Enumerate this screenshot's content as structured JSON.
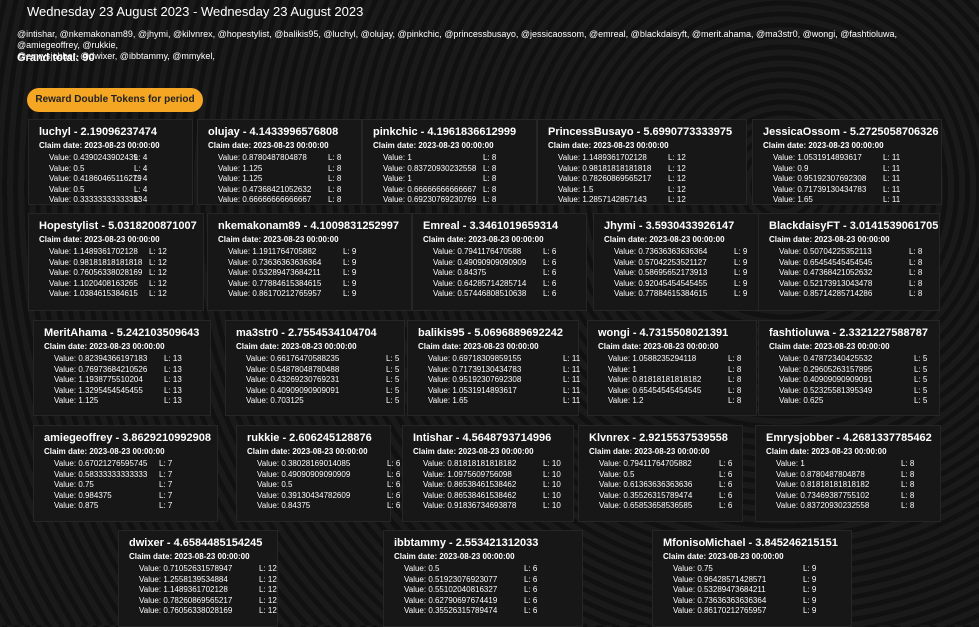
{
  "header": {
    "date_range": "Wednesday 23 August 2023 - Wednesday 23 August 2023",
    "users_line1": "@intishar, @nkemakonam89, @jhymi, @kilvnrex, @hopestylist, @balikis95, @luchyl, @olujay, @pinkchic, @princessbusayo, @jessicaossom, @emreal, @blackdaisyft, @merit.ahama, @ma3str0, @wongi, @fashtioluwa, @amiegeoffrey, @rukkie,",
    "users_line2": "@emrysjobber, @dwixer, @ibbtammy, @mmykel,",
    "grand_total": "Grand total: 90"
  },
  "reward_button": "Reward Double Tokens for period",
  "cards": [
    {
      "title": "luchyl - 2.19096237474",
      "claim": "Claim date: 2023-08-23 00:00:00",
      "rows": [
        [
          "Value: 0.4390243902439",
          "L: 4"
        ],
        [
          "Value: 0.5",
          "L: 4"
        ],
        [
          "Value: 0.41860465116279",
          "L: 4"
        ],
        [
          "Value: 0.5",
          "L: 4"
        ],
        [
          "Value: 0.33333333333333",
          "L: 4"
        ]
      ]
    },
    {
      "title": "olujay - 4.1433996576808",
      "claim": "Claim date: 2023-08-23 00:00:00",
      "rows": [
        [
          "Value: 0.8780487804878",
          "L: 8"
        ],
        [
          "Value: 1.125",
          "L: 8"
        ],
        [
          "Value: 1.125",
          "L: 8"
        ],
        [
          "Value: 0.47368421052632",
          "L: 8"
        ],
        [
          "Value: 0.66666666666667",
          "L: 8"
        ]
      ]
    },
    {
      "title": "pinkchic - 4.1961836612999",
      "claim": "Claim date: 2023-08-23 00:00:00",
      "rows": [
        [
          "Value: 1",
          "L: 8"
        ],
        [
          "Value: 0.83720930232558",
          "L: 8"
        ],
        [
          "Value: 1",
          "L: 8"
        ],
        [
          "Value: 0.66666666666667",
          "L: 8"
        ],
        [
          "Value: 0.69230769230769",
          "L: 8"
        ]
      ]
    },
    {
      "title": "PrincessBusayo - 5.6990773333975",
      "claim": "Claim date: 2023-08-23 00:00:00",
      "rows": [
        [
          "Value: 1.1489361702128",
          "L: 12"
        ],
        [
          "Value: 0.98181818181818",
          "L: 12"
        ],
        [
          "Value: 0.78260869565217",
          "L: 12"
        ],
        [
          "Value: 1.5",
          "L: 12"
        ],
        [
          "Value: 1.2857142857143",
          "L: 12"
        ]
      ]
    },
    {
      "title": "JessicaOssom - 5.2725058706326",
      "claim": "Claim date: 2023-08-23 00:00:00",
      "rows": [
        [
          "Value: 1.0531914893617",
          "L: 11"
        ],
        [
          "Value: 0.9",
          "L: 11"
        ],
        [
          "Value: 0.95192307692308",
          "L: 11"
        ],
        [
          "Value: 0.71739130434783",
          "L: 11"
        ],
        [
          "Value: 1.65",
          "L: 11"
        ]
      ]
    },
    {
      "title": "Hopestylist - 5.0318200871007",
      "claim": "Claim date: 2023-08-23 00:00:00",
      "rows": [
        [
          "Value: 1.1489361702128",
          "L: 12"
        ],
        [
          "Value: 0.98181818181818",
          "L: 12"
        ],
        [
          "Value: 0.76056338028169",
          "L: 12"
        ],
        [
          "Value: 1.1020408163265",
          "L: 12"
        ],
        [
          "Value: 1.0384615384615",
          "L: 12"
        ]
      ]
    },
    {
      "title": "nkemakonam89 - 4.1009831252997",
      "claim": "Claim date: 2023-08-23 00:00:00",
      "rows": [
        [
          "Value: 1.1911764705882",
          "L: 9"
        ],
        [
          "Value: 0.73636363636364",
          "L: 9"
        ],
        [
          "Value: 0.53289473684211",
          "L: 9"
        ],
        [
          "Value: 0.77884615384615",
          "L: 9"
        ],
        [
          "Value: 0.86170212765957",
          "L: 9"
        ]
      ]
    },
    {
      "title": "Emreal - 3.3461019659314",
      "claim": "Claim date: 2023-08-23 00:00:00",
      "rows": [
        [
          "Value: 0.7941176470588",
          "L: 6"
        ],
        [
          "Value: 0.49090909090909",
          "L: 6"
        ],
        [
          "Value: 0.84375",
          "L: 6"
        ],
        [
          "Value: 0.64285714285714",
          "L: 6"
        ],
        [
          "Value: 0.57446808510638",
          "L: 6"
        ]
      ]
    },
    {
      "title": "Jhymi - 3.5930433926147",
      "claim": "Claim date: 2023-08-23 00:00:00",
      "rows": [
        [
          "Value: 0.73636363636364",
          "L: 9"
        ],
        [
          "Value: 0.57042253521127",
          "L: 9"
        ],
        [
          "Value: 0.58695652173913",
          "L: 9"
        ],
        [
          "Value: 0.92045454545455",
          "L: 9"
        ],
        [
          "Value: 0.77884615384615",
          "L: 9"
        ]
      ]
    },
    {
      "title": "BlackdaisyFT - 3.0141539061705",
      "claim": "Claim date: 2023-08-23 00:00:00",
      "rows": [
        [
          "Value: 0.50704225352113",
          "L: 8"
        ],
        [
          "Value: 0.65454545454545",
          "L: 8"
        ],
        [
          "Value: 0.47368421052632",
          "L: 8"
        ],
        [
          "Value: 0.52173913043478",
          "L: 8"
        ],
        [
          "Value: 0.85714285714286",
          "L: 8"
        ]
      ]
    },
    {
      "title": "MeritAhama - 5.242103509643",
      "claim": "Claim date: 2023-08-23 00:00:00",
      "rows": [
        [
          "Value: 0.82394366197183",
          "L: 13"
        ],
        [
          "Value: 0.76973684210526",
          "L: 13"
        ],
        [
          "Value: 1.1938775510204",
          "L: 13"
        ],
        [
          "Value: 1.3295454545455",
          "L: 13"
        ],
        [
          "Value: 1.125",
          "L: 13"
        ]
      ]
    },
    {
      "title": "ma3str0 - 2.7554534104704",
      "claim": "Claim date: 2023-08-23 00:00:00",
      "rows": [
        [
          "Value: 0.66176470588235",
          "L: 5"
        ],
        [
          "Value: 0.54878048780488",
          "L: 5"
        ],
        [
          "Value: 0.43269230769231",
          "L: 5"
        ],
        [
          "Value: 0.40909090909091",
          "L: 5"
        ],
        [
          "Value: 0.703125",
          "L: 5"
        ]
      ]
    },
    {
      "title": "balikis95 - 5.0696889692242",
      "claim": "Claim date: 2023-08-23 00:00:00",
      "rows": [
        [
          "Value: 0.69718309859155",
          "L: 11"
        ],
        [
          "Value: 0.71739130434783",
          "L: 11"
        ],
        [
          "Value: 0.95192307692308",
          "L: 11"
        ],
        [
          "Value: 1.0531914893617",
          "L: 11"
        ],
        [
          "Value: 1.65",
          "L: 11"
        ]
      ]
    },
    {
      "title": "wongi - 4.7315508021391",
      "claim": "Claim date: 2023-08-23 00:00:00",
      "rows": [
        [
          "Value: 1.0588235294118",
          "L: 8"
        ],
        [
          "Value: 1",
          "L: 8"
        ],
        [
          "Value: 0.81818181818182",
          "L: 8"
        ],
        [
          "Value: 0.65454545454545",
          "L: 8"
        ],
        [
          "Value: 1.2",
          "L: 8"
        ]
      ]
    },
    {
      "title": "fashtioluwa - 2.3321227588787",
      "claim": "Claim date: 2023-08-23 00:00:00",
      "rows": [
        [
          "Value: 0.47872340425532",
          "L: 5"
        ],
        [
          "Value: 0.29605263157895",
          "L: 5"
        ],
        [
          "Value: 0.40909090909091",
          "L: 5"
        ],
        [
          "Value: 0.52325581395349",
          "L: 5"
        ],
        [
          "Value: 0.625",
          "L: 5"
        ]
      ]
    },
    {
      "title": "amiegeoffrey - 3.8629210992908",
      "claim": "Claim date: 2023-08-23 00:00:00",
      "rows": [
        [
          "Value: 0.67021276595745",
          "L: 7"
        ],
        [
          "Value: 0.58333333333333",
          "L: 7"
        ],
        [
          "Value: 0.75",
          "L: 7"
        ],
        [
          "Value: 0.984375",
          "L: 7"
        ],
        [
          "Value: 0.875",
          "L: 7"
        ]
      ]
    },
    {
      "title": "rukkie - 2.606245128876",
      "claim": "Claim date: 2023-08-23 00:00:00",
      "rows": [
        [
          "Value: 0.38028169014085",
          "L: 6"
        ],
        [
          "Value: 0.49090909090909",
          "L: 6"
        ],
        [
          "Value: 0.5",
          "L: 6"
        ],
        [
          "Value: 0.39130434782609",
          "L: 6"
        ],
        [
          "Value: 0.84375",
          "L: 6"
        ]
      ]
    },
    {
      "title": "Intishar - 4.5648793714996",
      "claim": "Claim date: 2023-08-23 00:00:00",
      "rows": [
        [
          "Value: 0.81818181818182",
          "L: 10"
        ],
        [
          "Value: 1.0975609756098",
          "L: 10"
        ],
        [
          "Value: 0.86538461538462",
          "L: 10"
        ],
        [
          "Value: 0.86538461538462",
          "L: 10"
        ],
        [
          "Value: 0.91836734693878",
          "L: 10"
        ]
      ]
    },
    {
      "title": "Klvnrex - 2.9215537539558",
      "claim": "Claim date: 2023-08-23 00:00:00",
      "rows": [
        [
          "Value: 0.79411764705882",
          "L: 6"
        ],
        [
          "Value: 0.5",
          "L: 6"
        ],
        [
          "Value: 0.61363636363636",
          "L: 6"
        ],
        [
          "Value: 0.35526315789474",
          "L: 6"
        ],
        [
          "Value: 0.65853658536585",
          "L: 6"
        ]
      ]
    },
    {
      "title": "Emrysjobber - 4.2681337785462",
      "claim": "Claim date: 2023-08-23 00:00:00",
      "rows": [
        [
          "Value: 1",
          "L: 8"
        ],
        [
          "Value: 0.8780487804878",
          "L: 8"
        ],
        [
          "Value: 0.81818181818182",
          "L: 8"
        ],
        [
          "Value: 0.73469387755102",
          "L: 8"
        ],
        [
          "Value: 0.83720930232558",
          "L: 8"
        ]
      ]
    },
    {
      "title": "dwixer - 4.6584485154245",
      "claim": "Claim date: 2023-08-23 00:00:00",
      "rows": [
        [
          "Value: 0.71052631578947",
          "L: 12"
        ],
        [
          "Value: 1.2558139534884",
          "L: 12"
        ],
        [
          "Value: 1.1489361702128",
          "L: 12"
        ],
        [
          "Value: 0.78260869565217",
          "L: 12"
        ],
        [
          "Value: 0.76056338028169",
          "L: 12"
        ]
      ]
    },
    {
      "title": "ibbtammy - 2.553421312033",
      "claim": "Claim date: 2023-08-23 00:00:00",
      "rows": [
        [
          "Value: 0.5",
          "L: 6"
        ],
        [
          "Value: 0.51923076923077",
          "L: 6"
        ],
        [
          "Value: 0.55102040816327",
          "L: 6"
        ],
        [
          "Value: 0.62790697674419",
          "L: 6"
        ],
        [
          "Value: 0.35526315789474",
          "L: 6"
        ]
      ]
    },
    {
      "title": "MfonisoMichael - 3.845246215151",
      "claim": "Claim date: 2023-08-23 00:00:00",
      "rows": [
        [
          "Value: 0.75",
          "L: 9"
        ],
        [
          "Value: 0.96428571428571",
          "L: 9"
        ],
        [
          "Value: 0.53289473684211",
          "L: 9"
        ],
        [
          "Value: 0.73636363636364",
          "L: 9"
        ],
        [
          "Value: 0.86170212765957",
          "L: 9"
        ]
      ]
    }
  ]
}
